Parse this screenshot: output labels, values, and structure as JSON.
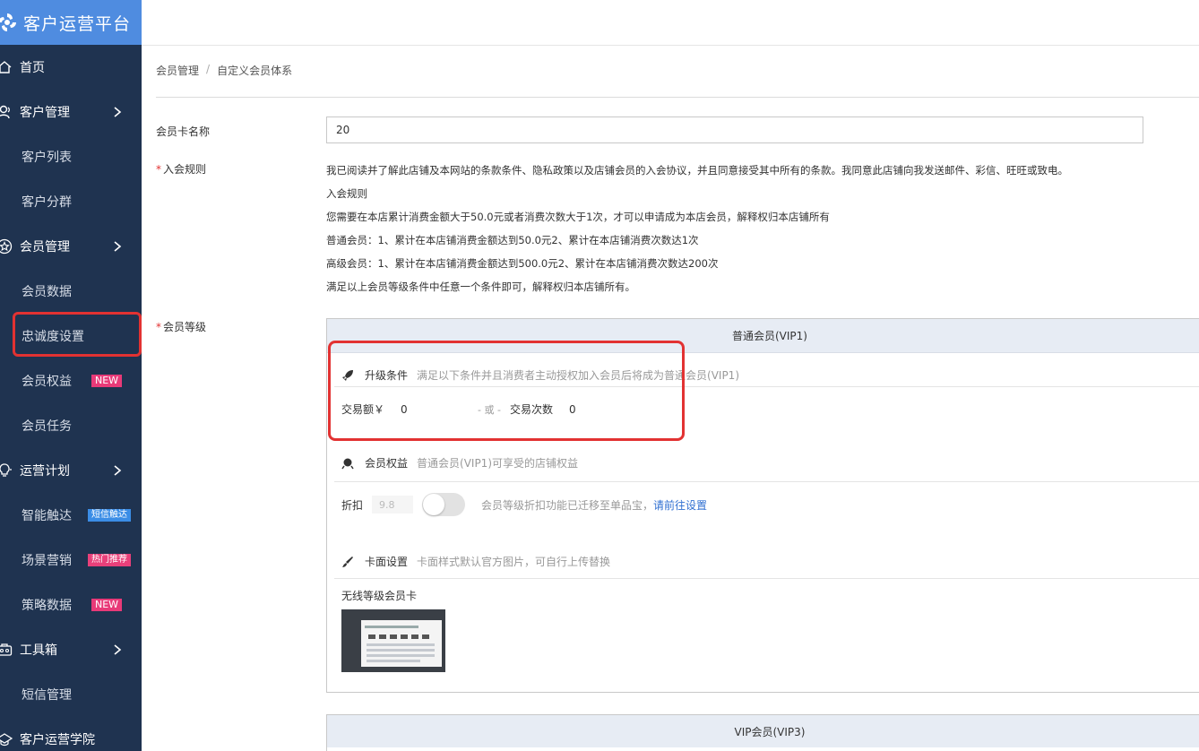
{
  "app": {
    "title": "客户运营平台"
  },
  "sidebar": {
    "items": [
      {
        "label": "首页",
        "type": "top",
        "icon": "home-icon"
      },
      {
        "label": "客户管理",
        "type": "top",
        "icon": "customer-icon",
        "expandable": true
      },
      {
        "label": "客户列表",
        "type": "sub"
      },
      {
        "label": "客户分群",
        "type": "sub"
      },
      {
        "label": "会员管理",
        "type": "top",
        "icon": "star-icon",
        "expandable": true
      },
      {
        "label": "会员数据",
        "type": "sub"
      },
      {
        "label": "忠诚度设置",
        "type": "sub",
        "highlighted": true
      },
      {
        "label": "会员权益",
        "type": "sub",
        "badge": "NEW"
      },
      {
        "label": "会员任务",
        "type": "sub"
      },
      {
        "label": "运营计划",
        "type": "top",
        "icon": "bulb-icon",
        "expandable": true
      },
      {
        "label": "智能触达",
        "type": "sub",
        "badge": "短信触达"
      },
      {
        "label": "场景营销",
        "type": "sub",
        "badge": "热门推荐"
      },
      {
        "label": "策略数据",
        "type": "sub",
        "badge": "NEW"
      },
      {
        "label": "工具箱",
        "type": "top",
        "icon": "toolbox-icon",
        "expandable": true
      },
      {
        "label": "短信管理",
        "type": "sub"
      },
      {
        "label": "客户运营学院",
        "type": "top",
        "icon": "academy-icon"
      }
    ]
  },
  "breadcrumb": {
    "parent": "会员管理",
    "separator": "/",
    "current": "自定义会员体系"
  },
  "form": {
    "card_name_label": "会员卡名称",
    "card_name_value": "20",
    "join_rule_label": "入会规则",
    "join_rule_lines": [
      "我已阅读并了解此店铺及本网站的条款条件、隐私政策以及店铺会员的入会协议，并且同意接受其中所有的条款。我同意此店铺向我发送邮件、彩信、旺旺或致电。",
      "入会规则",
      "您需要在本店累计消费金额大于50.0元或者消费次数大于1次，才可以申请成为本店会员，解释权归本店铺所有",
      "普通会员：1、累计在本店铺消费金额达到50.0元2、累计在本店铺消费次数达1次",
      "高级会员：1、累计在本店铺消费金额达到500.0元2、累计在本店铺消费次数达200次",
      "满足以上会员等级条件中任意一个条件即可，解释权归本店铺所有。"
    ],
    "level_label": "会员等级",
    "required_mark": "*"
  },
  "level_panel": {
    "title": "普通会员(VIP1)",
    "upgrade": {
      "title": "升级条件",
      "desc": "满足以下条件并且消费者主动授权加入会员后将成为普通会员(VIP1)",
      "amount_label": "交易额￥",
      "amount_value": "0",
      "or_text": "- 或 -",
      "count_label": "交易次数",
      "count_value": "0"
    },
    "benefits": {
      "title": "会员权益",
      "desc": "普通会员(VIP1)可享受的店铺权益",
      "discount_label": "折扣",
      "discount_value": "9.8",
      "toggle_on": false,
      "migrate_note": "会员等级折扣功能已迁移至单品宝，",
      "migrate_link": "请前往设置"
    },
    "card_face": {
      "title": "卡面设置",
      "desc": "卡面样式默认官方图片，可自行上传替换",
      "wireless_label": "无线等级会员卡"
    }
  },
  "level_panel2": {
    "title": "VIP会员(VIP3)"
  },
  "colors": {
    "sidebar_bg": "#1f3350",
    "logo_bg": "#4f8ce0",
    "highlight": "#e23232",
    "link": "#2f6fd1"
  }
}
